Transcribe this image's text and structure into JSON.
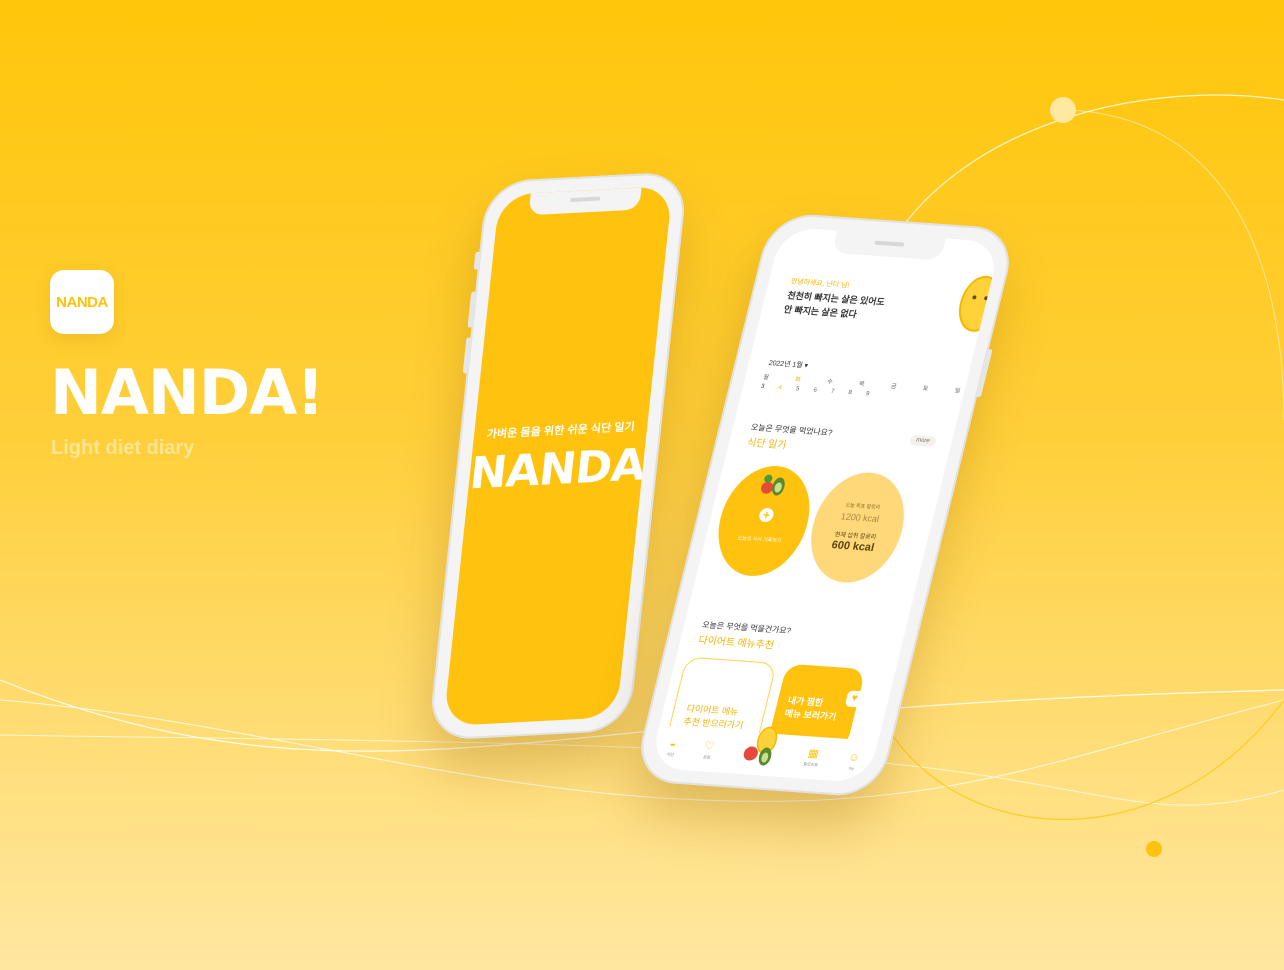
{
  "brand": {
    "icon_label": "NANDA",
    "title": "NANDA!",
    "subtitle": "Light diet diary"
  },
  "splash": {
    "tagline": "가벼운 몸을 위한 쉬운 식단 일기",
    "logo": "NANDA"
  },
  "home": {
    "greeting": "안녕하세요, 난다 님!",
    "message_line1": "천천히 빠지는 살은 있어도",
    "message_line2": "안 빠지는 살은 없다",
    "date_selector": "2022년 1월 ▾",
    "weekdays": [
      "월",
      "화",
      "수",
      "목",
      "금",
      "토",
      "일"
    ],
    "dates": [
      "3",
      "4",
      "5",
      "6",
      "7",
      "8",
      "9"
    ],
    "question1": "오늘은 무엇을 먹었나요?",
    "section1_title": "식단 일기",
    "more_button": "more",
    "record_label": "오늘의 식사 기록하기",
    "goal_label": "오늘 목표 칼로리",
    "goal_value": "1200 kcal",
    "current_label": "현재 섭취 칼로리",
    "current_value": "600 kcal",
    "question2": "오늘은 무엇을 먹을건가요?",
    "section2_title": "다이어트 메뉴추천",
    "card1_line1": "다이어트 메뉴",
    "card1_line2": "추천 받으러가기",
    "card2_line1": "내가 찜한",
    "card2_line2": "메뉴 보러가기",
    "tabs": [
      {
        "label": "식단",
        "icon": "egg-icon"
      },
      {
        "label": "운동",
        "icon": "heart-pulse-icon"
      },
      {
        "label": "",
        "icon": "mascot-fab-icon"
      },
      {
        "label": "칼로리표",
        "icon": "grid-icon"
      },
      {
        "label": "my",
        "icon": "smile-icon"
      }
    ]
  },
  "colors": {
    "brand_yellow": "#FFC20E",
    "accent_text": "#F2B400",
    "light_yellow": "#FFD87A"
  }
}
